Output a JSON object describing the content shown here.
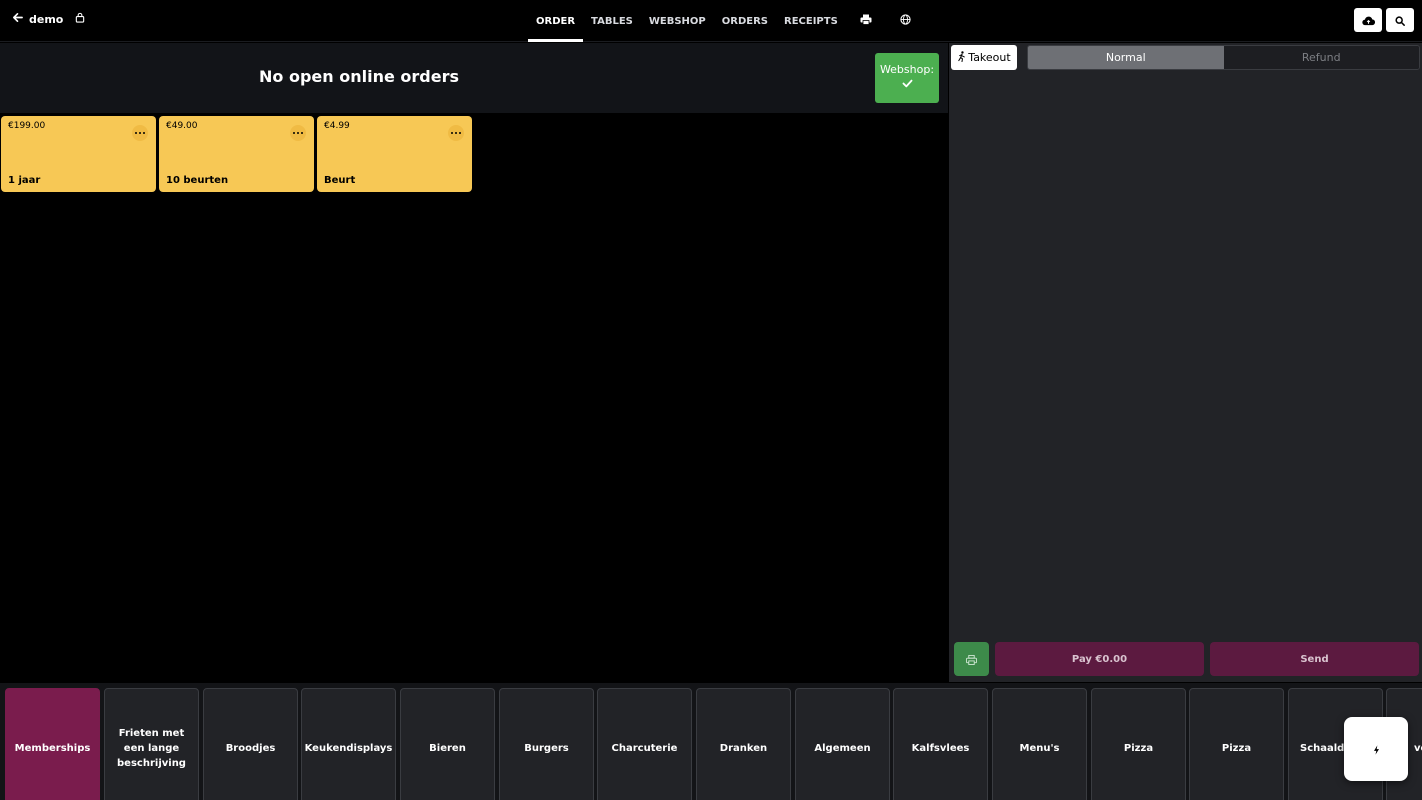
{
  "header": {
    "back_label": "demo",
    "tabs": [
      {
        "label": "ORDER",
        "active": true
      },
      {
        "label": "TABLES",
        "active": false
      },
      {
        "label": "WEBSHOP",
        "active": false
      },
      {
        "label": "ORDERS",
        "active": false
      },
      {
        "label": "RECEIPTS",
        "active": false
      }
    ],
    "icons": [
      "arrow-left-icon",
      "lock-icon",
      "printer-icon",
      "globe-icon",
      "cloud-upload-icon",
      "search-icon"
    ]
  },
  "banner": {
    "title": "No open online orders",
    "webshop_label": "Webshop:",
    "webshop_color": "#4caf50"
  },
  "products": [
    {
      "price": "€199.00",
      "name": "1 jaar"
    },
    {
      "price": "€49.00",
      "name": "10 beurten"
    },
    {
      "price": "€4.99",
      "name": "Beurt"
    }
  ],
  "product_color": "#f7c855",
  "order_panel": {
    "takeout_label": "Takeout",
    "mode_normal": "Normal",
    "mode_refund": "Refund",
    "pay_label": "Pay €0.00",
    "send_label": "Send"
  },
  "categories": [
    {
      "label": "Memberships",
      "active": true
    },
    {
      "label": "Frieten met een lange beschrijving",
      "active": false
    },
    {
      "label": "Broodjes",
      "active": false
    },
    {
      "label": "Keukendisplays",
      "active": false
    },
    {
      "label": "Bieren",
      "active": false
    },
    {
      "label": "Burgers",
      "active": false
    },
    {
      "label": "Charcuterie",
      "active": false
    },
    {
      "label": "Dranken",
      "active": false
    },
    {
      "label": "Algemeen",
      "active": false
    },
    {
      "label": "Kalfsvlees",
      "active": false
    },
    {
      "label": "Menu's",
      "active": false
    },
    {
      "label": "Pizza",
      "active": false
    },
    {
      "label": "Pizza",
      "active": false
    },
    {
      "label": "Schaaldi",
      "active": false
    },
    {
      "label": "ve",
      "active": false
    }
  ],
  "accent_color": "#7a1c4d"
}
